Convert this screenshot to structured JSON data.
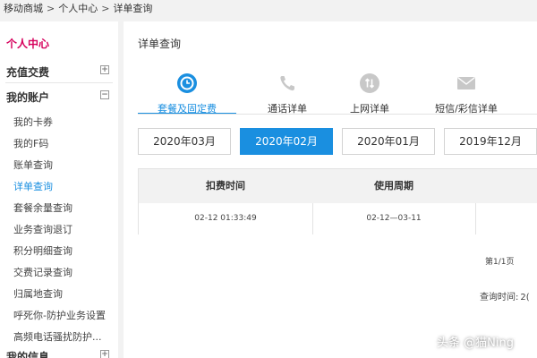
{
  "breadcrumb": [
    "移动商城",
    "个人中心",
    "详单查询"
  ],
  "breadcrumb_sep": ">",
  "sidebar": {
    "title": "个人中心",
    "groups": [
      {
        "label": "充值交费",
        "toggle": "+"
      },
      {
        "label": "我的账户",
        "toggle": "−"
      }
    ],
    "items": [
      "我的卡券",
      "我的F码",
      "账单查询",
      "详单查询",
      "套餐余量查询",
      "业务查询退订",
      "积分明细查询",
      "交费记录查询",
      "归属地查询",
      "呼死你-防护业务设置",
      "高频电话骚扰防护..."
    ],
    "bottom_group": {
      "label": "我的信息",
      "toggle": "+"
    }
  },
  "main": {
    "title": "详单查询",
    "tabs": [
      {
        "label": "套餐及固定费",
        "icon": "clock-icon"
      },
      {
        "label": "通话详单",
        "icon": "phone-icon"
      },
      {
        "label": "上网详单",
        "icon": "data-transfer-icon"
      },
      {
        "label": "短信/彩信详单",
        "icon": "envelope-icon"
      }
    ],
    "months": [
      "2020年03月",
      "2020年02月",
      "2020年01月",
      "2019年12月"
    ],
    "table": {
      "headers": [
        "扣费时间",
        "使用周期"
      ],
      "rows": [
        [
          "02-12 01:33:49",
          "02-12—03-11"
        ]
      ]
    },
    "pager": "第1/1页",
    "query_time_label": "查询时间:",
    "query_time_value": "2("
  },
  "watermark": "头条 @猫Ning",
  "colors": {
    "accent": "#1a8fe0",
    "highlight": "#d6005c"
  }
}
